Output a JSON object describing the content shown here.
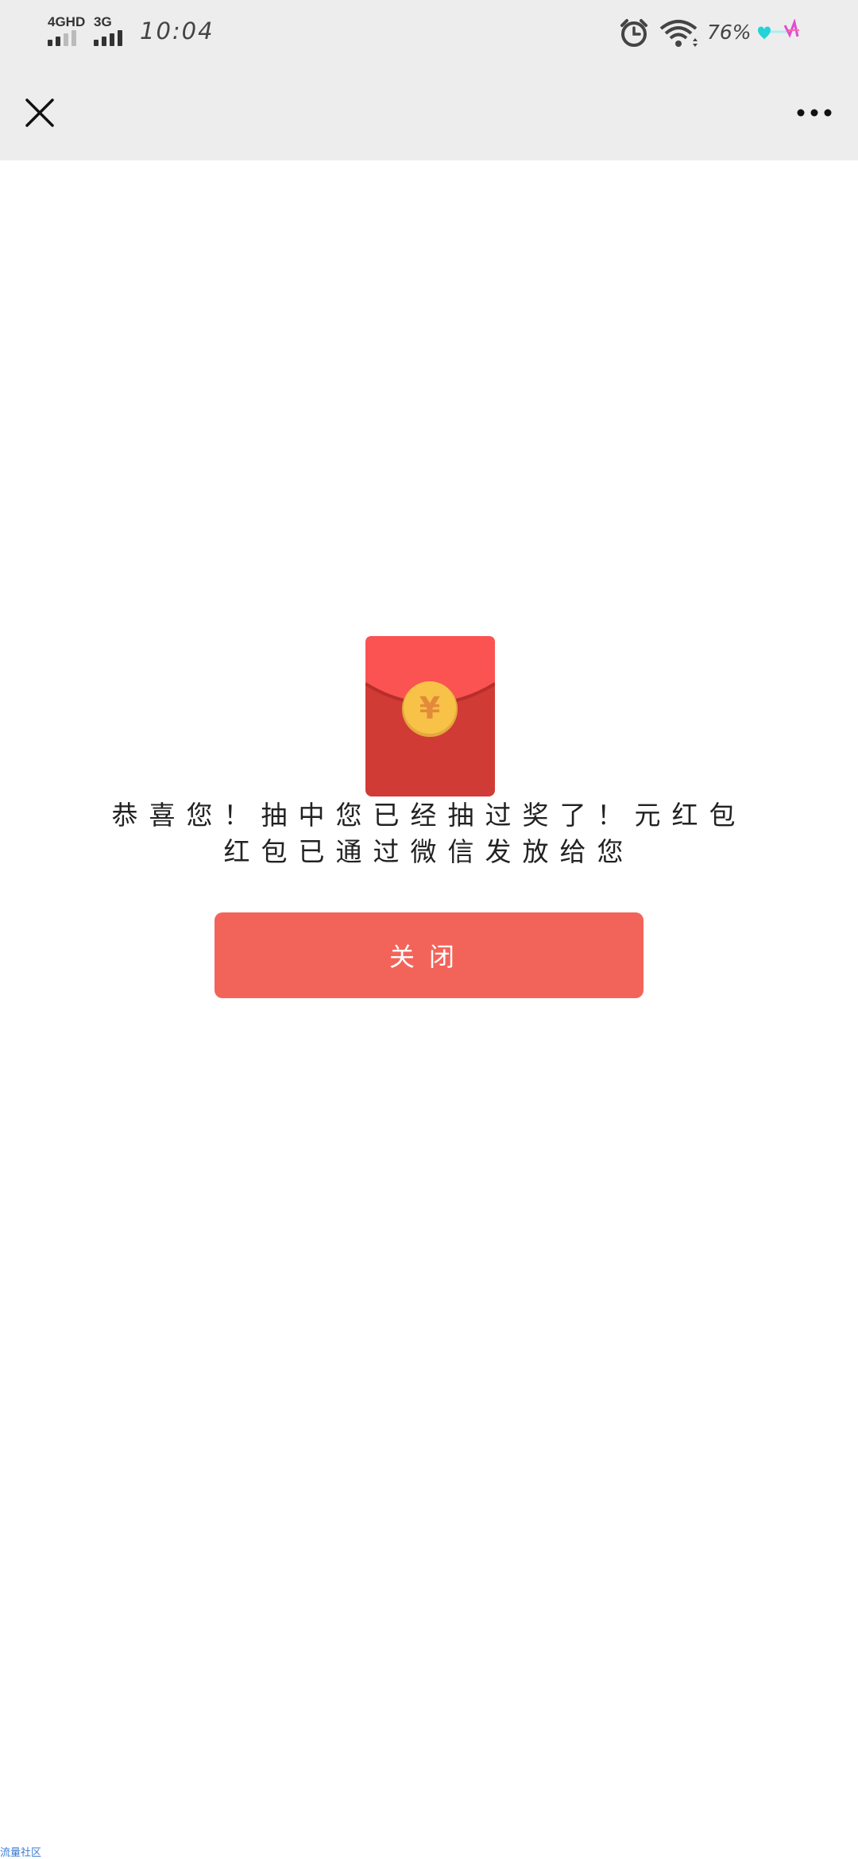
{
  "status_bar": {
    "network_1": "4GHD",
    "network_2": "3G",
    "time": "10:04",
    "battery": "76%",
    "icons": [
      "alarm-icon",
      "wifi-icon",
      "battery-heart-icon"
    ]
  },
  "nav": {
    "close_icon": "close-icon",
    "more_icon": "more-dots-icon"
  },
  "content": {
    "envelope_icon": "red-envelope-icon",
    "currency_symbol": "¥",
    "message_line1": "恭喜您！抽中您已经抽过奖了！元红包",
    "message_line2": "红包已通过微信发放给您",
    "close_button_label": "关闭"
  },
  "watermark": "流量社区",
  "colors": {
    "header_bg": "#ededed",
    "button": "#f2645a",
    "envelope_top": "#fb5352",
    "envelope_body": "#d13b35",
    "coin": "#f7c247"
  }
}
